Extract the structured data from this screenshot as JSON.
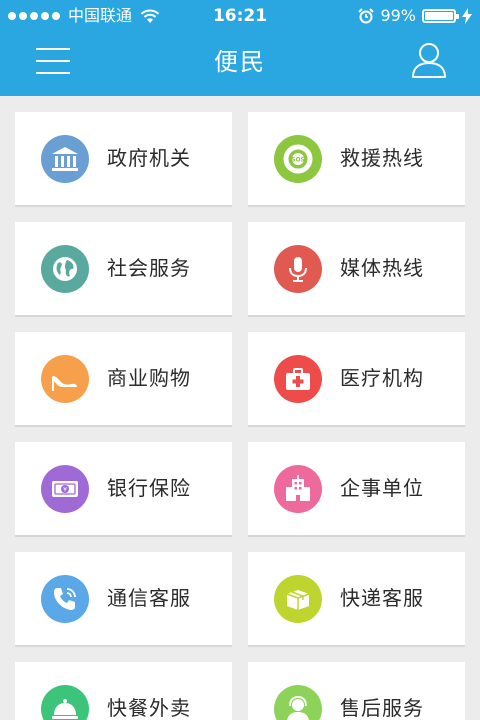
{
  "status_bar": {
    "carrier": "中国联通",
    "time": "16:21",
    "battery_percent": "99%",
    "battery_level": 0.99,
    "signal_dots": 5
  },
  "nav": {
    "title": "便民"
  },
  "colors": {
    "header": "#2aa7e0",
    "background": "#ececec"
  },
  "items": [
    {
      "label": "政府机关",
      "icon": "government-building-icon",
      "color": "#6a9fd3"
    },
    {
      "label": "救援热线",
      "icon": "sos-lifebuoy-icon",
      "color": "#8dc63f"
    },
    {
      "label": "社会服务",
      "icon": "globe-icon",
      "color": "#5aa99e"
    },
    {
      "label": "媒体热线",
      "icon": "microphone-icon",
      "color": "#e05a52"
    },
    {
      "label": "商业购物",
      "icon": "high-heel-icon",
      "color": "#f6a04b"
    },
    {
      "label": "医疗机构",
      "icon": "first-aid-kit-icon",
      "color": "#ee4b4b"
    },
    {
      "label": "银行保险",
      "icon": "banknote-icon",
      "color": "#a06ad6"
    },
    {
      "label": "企事单位",
      "icon": "office-building-icon",
      "color": "#ee6a9c"
    },
    {
      "label": "通信客服",
      "icon": "phone-icon",
      "color": "#5aa8e8"
    },
    {
      "label": "快递客服",
      "icon": "parcel-box-icon",
      "color": "#bfd52f"
    },
    {
      "label": "快餐外卖",
      "icon": "food-cloche-icon",
      "color": "#3cc47a"
    },
    {
      "label": "售后服务",
      "icon": "user-headset-icon",
      "color": "#8dd35a"
    }
  ]
}
